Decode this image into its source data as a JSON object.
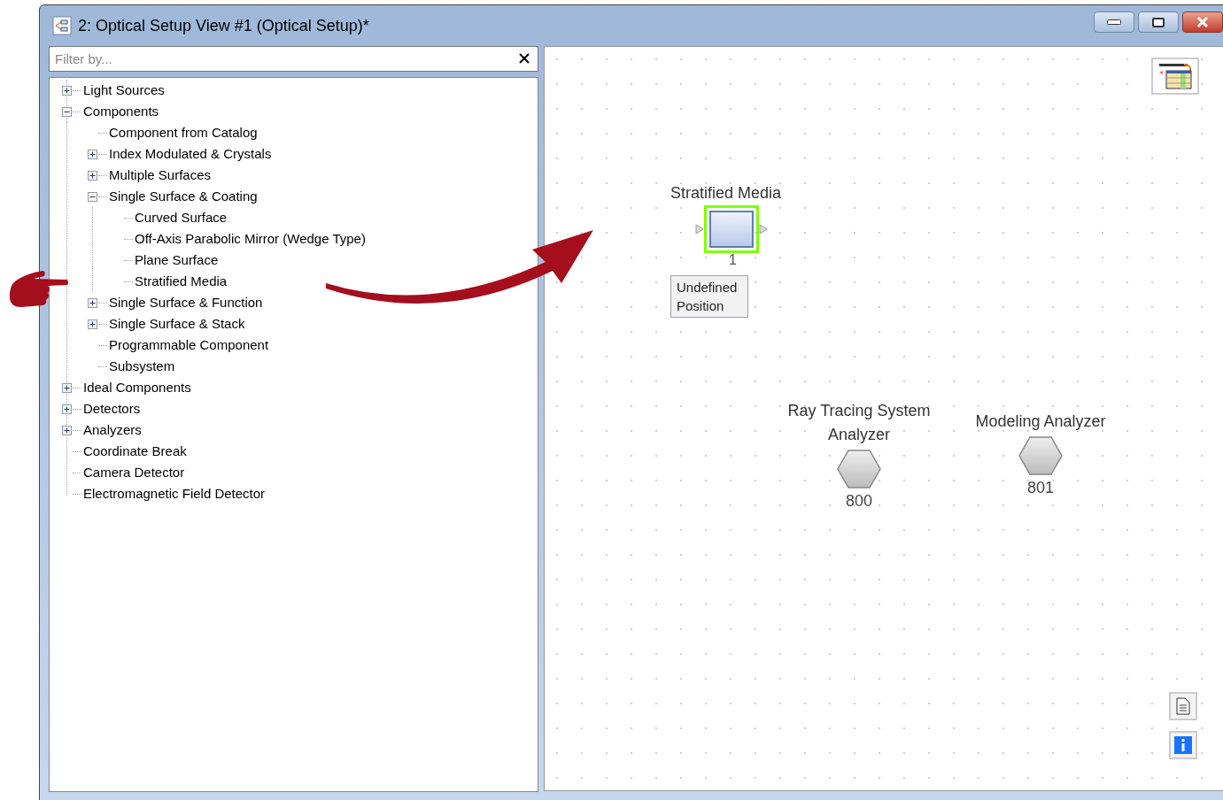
{
  "window": {
    "title": "2: Optical Setup View #1 (Optical Setup)*"
  },
  "filter": {
    "placeholder": "Filter by..."
  },
  "tree": [
    {
      "label": "Light Sources",
      "expanded": false
    },
    {
      "label": "Components",
      "expanded": true,
      "children": [
        {
          "label": "Component from Catalog"
        },
        {
          "label": "Index Modulated & Crystals",
          "expanded": false
        },
        {
          "label": "Multiple Surfaces",
          "expanded": false
        },
        {
          "label": "Single Surface & Coating",
          "expanded": true,
          "children": [
            {
              "label": "Curved Surface"
            },
            {
              "label": "Off-Axis Parabolic Mirror (Wedge Type)"
            },
            {
              "label": "Plane Surface"
            },
            {
              "label": "Stratified Media"
            }
          ]
        },
        {
          "label": "Single Surface & Function",
          "expanded": false
        },
        {
          "label": "Single Surface & Stack",
          "expanded": false
        },
        {
          "label": "Programmable Component"
        },
        {
          "label": "Subsystem"
        }
      ]
    },
    {
      "label": "Ideal Components",
      "expanded": false
    },
    {
      "label": "Detectors",
      "expanded": false
    },
    {
      "label": "Analyzers",
      "expanded": false
    },
    {
      "label": "Coordinate Break"
    },
    {
      "label": "Camera Detector"
    },
    {
      "label": "Electromagnetic Field Detector"
    }
  ],
  "canvas": {
    "nodes": [
      {
        "kind": "component",
        "label": "Stratified Media",
        "number": "1",
        "selected": true,
        "position": "Undefined Position"
      },
      {
        "kind": "analyzer",
        "label": "Ray Tracing System Analyzer",
        "number": "800"
      },
      {
        "kind": "analyzer",
        "label": "Modeling Analyzer",
        "number": "801"
      }
    ]
  }
}
